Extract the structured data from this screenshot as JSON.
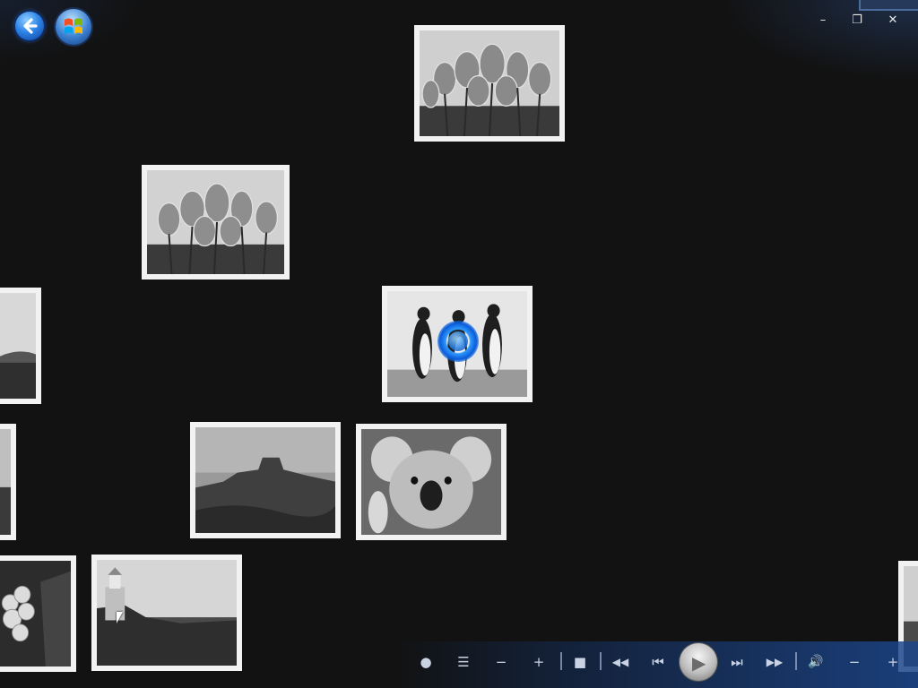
{
  "window": {
    "back_icon": "back-arrow-icon",
    "start_icon": "windows-logo-icon",
    "controls": {
      "minimize": "–",
      "restore": "❐",
      "close": "✕"
    }
  },
  "photos": [
    {
      "name": "tulips-photo-top",
      "subject": "tulips"
    },
    {
      "name": "tulips-photo",
      "subject": "tulips"
    },
    {
      "name": "coast-photo-left-edge",
      "subject": "coast"
    },
    {
      "name": "penguins-photo",
      "subject": "penguins"
    },
    {
      "name": "edge-photo-left",
      "subject": "unknown"
    },
    {
      "name": "desert-photo",
      "subject": "desert"
    },
    {
      "name": "koala-photo",
      "subject": "koala"
    },
    {
      "name": "hydrangea-photo",
      "subject": "hydrangea"
    },
    {
      "name": "lighthouse-photo",
      "subject": "lighthouse"
    },
    {
      "name": "edge-photo-right",
      "subject": "unknown"
    }
  ],
  "player": {
    "record": "●",
    "list": "☰",
    "minus": "−",
    "plus": "+",
    "stop": "■",
    "rewind": "◀◀",
    "prev": "⏮",
    "play": "▶",
    "next": "⏭",
    "fast_forward": "▶▶",
    "volume": "🔊",
    "vol_minus": "−",
    "vol_plus": "+"
  },
  "colors": {
    "accent": "#2f85e8",
    "background": "#121212"
  }
}
